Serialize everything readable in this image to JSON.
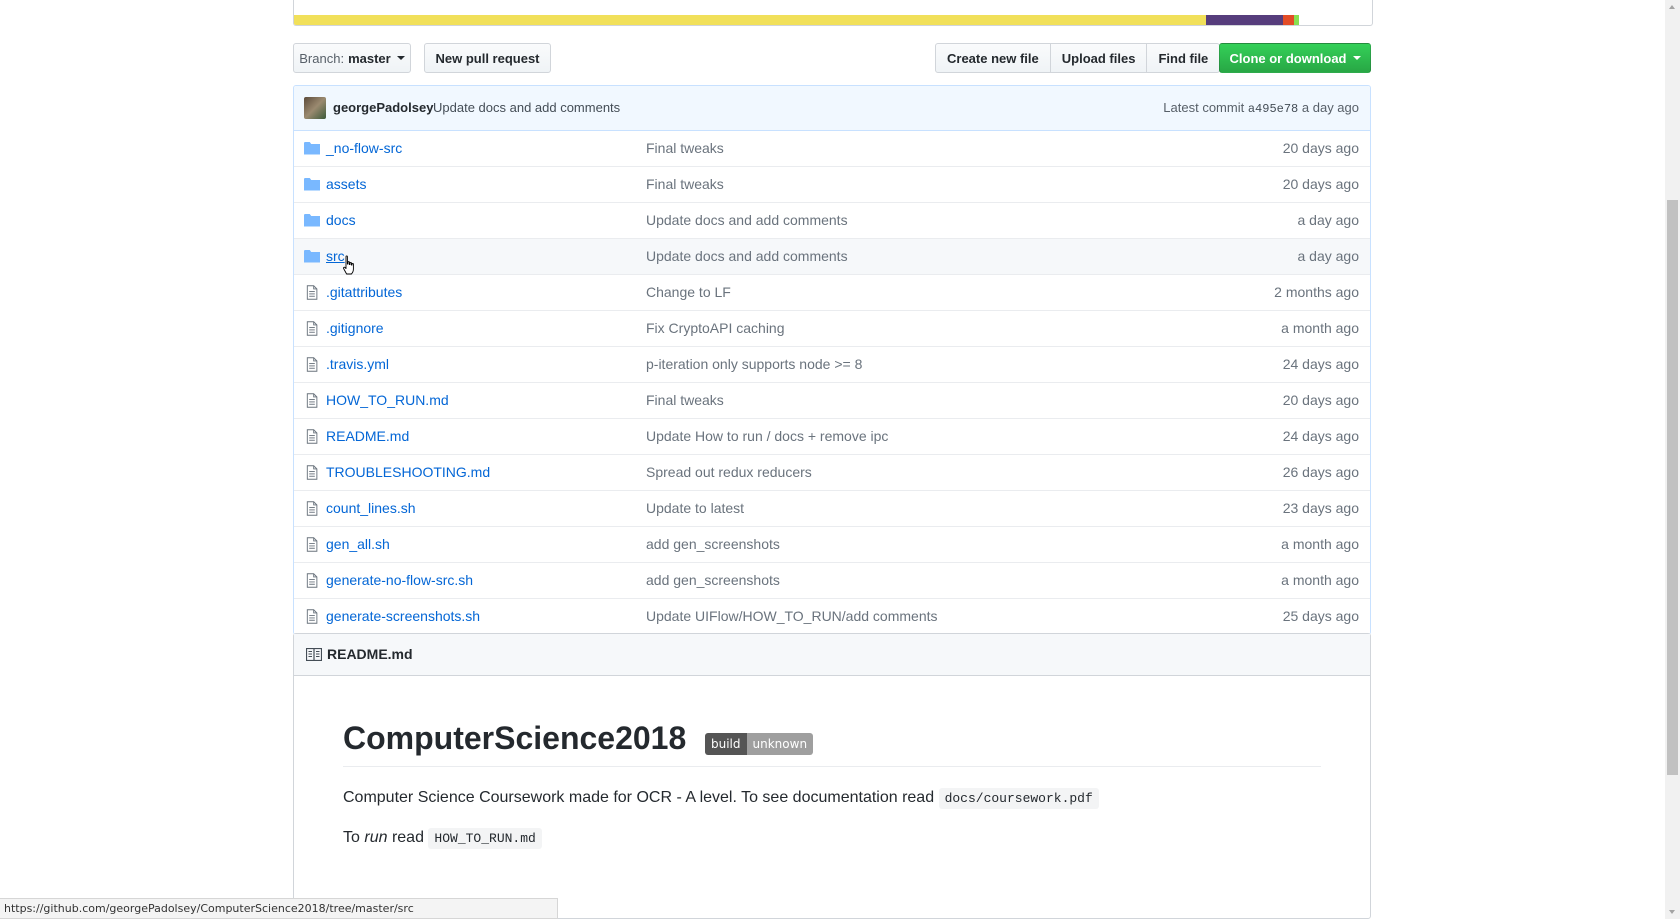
{
  "language_bar": {
    "segments": [
      {
        "color": "#f1e05a",
        "fraction": 0.846
      },
      {
        "color": "#563d7c",
        "fraction": 0.071
      },
      {
        "color": "#e34c26",
        "fraction": 0.011
      },
      {
        "color": "#89e051",
        "fraction": 0.004
      }
    ]
  },
  "toolbar": {
    "branch_prefix": "Branch:",
    "branch_name": "master",
    "new_pull_request": "New pull request",
    "create_new_file": "Create new file",
    "upload_files": "Upload files",
    "find_file": "Find file",
    "clone_or_download": "Clone or download"
  },
  "commit": {
    "author": "georgePadolsey",
    "message": "Update docs and add comments",
    "latest_label": "Latest commit",
    "sha": "a495e78",
    "age": "a day ago"
  },
  "files": [
    {
      "type": "folder",
      "name": "_no-flow-src",
      "message": "Final tweaks",
      "age": "20 days ago"
    },
    {
      "type": "folder",
      "name": "assets",
      "message": "Final tweaks",
      "age": "20 days ago"
    },
    {
      "type": "folder",
      "name": "docs",
      "message": "Update docs and add comments",
      "age": "a day ago"
    },
    {
      "type": "folder",
      "name": "src",
      "message": "Update docs and add comments",
      "age": "a day ago"
    },
    {
      "type": "file",
      "name": ".gitattributes",
      "message": "Change to LF",
      "age": "2 months ago"
    },
    {
      "type": "file",
      "name": ".gitignore",
      "message": "Fix CryptoAPI caching",
      "age": "a month ago"
    },
    {
      "type": "file",
      "name": ".travis.yml",
      "message": "p-iteration only supports node >= 8",
      "age": "24 days ago"
    },
    {
      "type": "file",
      "name": "HOW_TO_RUN.md",
      "message": "Final tweaks",
      "age": "20 days ago"
    },
    {
      "type": "file",
      "name": "README.md",
      "message": "Update How to run / docs + remove ipc",
      "age": "24 days ago"
    },
    {
      "type": "file",
      "name": "TROUBLESHOOTING.md",
      "message": "Spread out redux reducers",
      "age": "26 days ago"
    },
    {
      "type": "file",
      "name": "count_lines.sh",
      "message": "Update to latest",
      "age": "23 days ago"
    },
    {
      "type": "file",
      "name": "gen_all.sh",
      "message": "add gen_screenshots",
      "age": "a month ago"
    },
    {
      "type": "file",
      "name": "generate-no-flow-src.sh",
      "message": "add gen_screenshots",
      "age": "a month ago"
    },
    {
      "type": "file",
      "name": "generate-screenshots.sh",
      "message": "Update UIFlow/HOW_TO_RUN/add comments",
      "age": "25 days ago"
    }
  ],
  "hovered_file": "src",
  "readme": {
    "filename": "README.md",
    "heading": "ComputerScience2018",
    "badge_left": "build",
    "badge_right": "unknown",
    "para1_text": "Computer Science Coursework made for OCR - A level. To see documentation read",
    "para1_code": "docs/coursework.pdf",
    "para2_prefix": "To",
    "para2_em": "run",
    "para2_middle": "read",
    "para2_code": "HOW_TO_RUN.md"
  },
  "status_bar": {
    "url": "https://github.com/georgePadolsey/ComputerScience2018/tree/master/src"
  },
  "colors": {
    "link": "#0366d6",
    "clone_green": "#28a745",
    "commit_tease_bg": "#f1f8ff",
    "folder_icon": "#79b8ff"
  }
}
